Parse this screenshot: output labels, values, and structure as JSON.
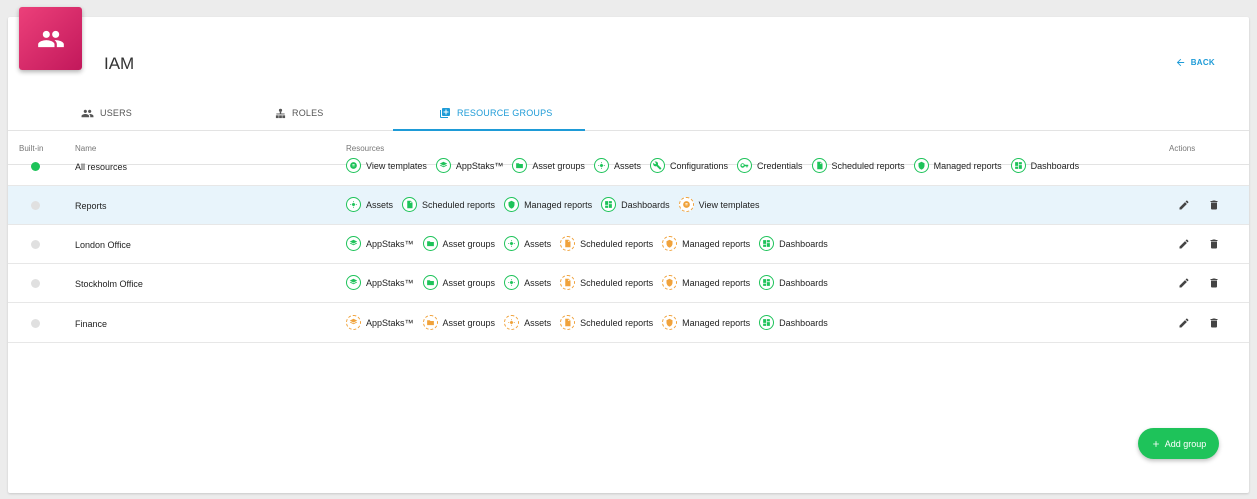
{
  "app": {
    "title": "IAM",
    "back_label": "BACK",
    "logo_icon": "users-icon"
  },
  "colors": {
    "accent": "#1e9bd7",
    "brand": "#d81b60",
    "full": "#1ec35a",
    "partial": "#f0a23b"
  },
  "tabs": [
    {
      "label": "USERS",
      "icon": "users-icon",
      "active": false
    },
    {
      "label": "ROLES",
      "icon": "roles-icon",
      "active": false
    },
    {
      "label": "RESOURCE GROUPS",
      "icon": "resource-groups-icon",
      "active": true
    }
  ],
  "table": {
    "headers": {
      "builtin": "Built-in",
      "name": "Name",
      "resources": "Resources",
      "actions": "Actions"
    },
    "rows": [
      {
        "name": "All resources",
        "builtin": true,
        "selected": false,
        "editable": false,
        "resources": [
          {
            "label": "View templates",
            "status": "full"
          },
          {
            "label": "AppStaks™",
            "status": "full"
          },
          {
            "label": "Asset groups",
            "status": "full"
          },
          {
            "label": "Assets",
            "status": "full"
          },
          {
            "label": "Configurations",
            "status": "full"
          },
          {
            "label": "Credentials",
            "status": "full"
          },
          {
            "label": "Scheduled reports",
            "status": "full"
          },
          {
            "label": "Managed reports",
            "status": "full"
          },
          {
            "label": "Dashboards",
            "status": "full"
          }
        ]
      },
      {
        "name": "Reports",
        "builtin": false,
        "selected": true,
        "editable": true,
        "resources": [
          {
            "label": "Assets",
            "status": "full"
          },
          {
            "label": "Scheduled reports",
            "status": "full"
          },
          {
            "label": "Managed reports",
            "status": "full"
          },
          {
            "label": "Dashboards",
            "status": "full"
          },
          {
            "label": "View templates",
            "status": "partial"
          }
        ]
      },
      {
        "name": "London Office",
        "builtin": false,
        "selected": false,
        "editable": true,
        "resources": [
          {
            "label": "AppStaks™",
            "status": "full"
          },
          {
            "label": "Asset groups",
            "status": "full"
          },
          {
            "label": "Assets",
            "status": "full"
          },
          {
            "label": "Scheduled reports",
            "status": "partial"
          },
          {
            "label": "Managed reports",
            "status": "partial"
          },
          {
            "label": "Dashboards",
            "status": "full"
          }
        ]
      },
      {
        "name": "Stockholm Office",
        "builtin": false,
        "selected": false,
        "editable": true,
        "resources": [
          {
            "label": "AppStaks™",
            "status": "full"
          },
          {
            "label": "Asset groups",
            "status": "full"
          },
          {
            "label": "Assets",
            "status": "full"
          },
          {
            "label": "Scheduled reports",
            "status": "partial"
          },
          {
            "label": "Managed reports",
            "status": "partial"
          },
          {
            "label": "Dashboards",
            "status": "full"
          }
        ]
      },
      {
        "name": "Finance",
        "builtin": false,
        "selected": false,
        "editable": true,
        "resources": [
          {
            "label": "AppStaks™",
            "status": "partial"
          },
          {
            "label": "Asset groups",
            "status": "partial"
          },
          {
            "label": "Assets",
            "status": "partial"
          },
          {
            "label": "Scheduled reports",
            "status": "partial"
          },
          {
            "label": "Managed reports",
            "status": "partial"
          },
          {
            "label": "Dashboards",
            "status": "full"
          }
        ]
      }
    ]
  },
  "fab": {
    "label": "Add group",
    "icon": "plus-icon"
  }
}
